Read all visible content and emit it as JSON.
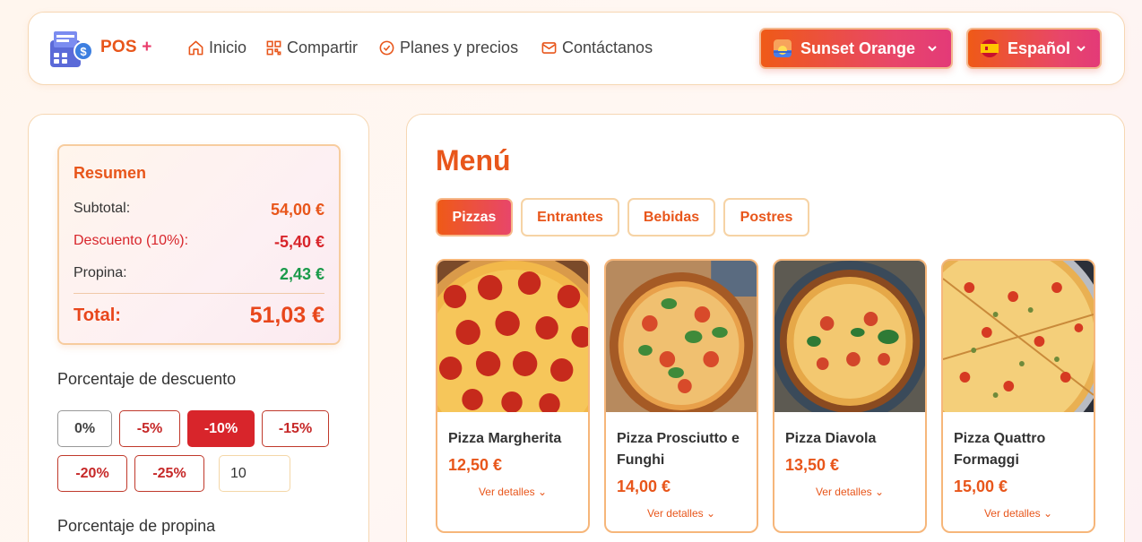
{
  "navbar": {
    "brand": "POS",
    "brand_plus": "+",
    "links": [
      {
        "label": "Inicio",
        "icon": "home-icon"
      },
      {
        "label": "Compartir",
        "icon": "qr-code-icon"
      },
      {
        "label": "Planes y precios",
        "icon": "check-badge-icon"
      },
      {
        "label": "Contáctanos",
        "icon": "mail-icon"
      }
    ],
    "theme_selector": {
      "label": "Sunset Orange",
      "icon": "sunset-emoji-icon"
    },
    "language_selector": {
      "label": "Español",
      "icon": "spain-flag-icon"
    }
  },
  "summary": {
    "title": "Resumen",
    "subtotal_label": "Subtotal:",
    "subtotal_value": "54,00 €",
    "discount_label": "Descuento (10%):",
    "discount_value": "-5,40 €",
    "tip_label": "Propina:",
    "tip_value": "2,43 €",
    "total_label": "Total:",
    "total_value": "51,03 €"
  },
  "discount": {
    "label": "Porcentaje de descuento",
    "options": [
      "0%",
      "-5%",
      "-10%",
      "-15%",
      "-20%",
      "-25%"
    ],
    "selected": "-10%",
    "custom_value": "10"
  },
  "tip": {
    "label": "Porcentaje de propina"
  },
  "menu": {
    "title": "Menú",
    "categories": [
      "Pizzas",
      "Entrantes",
      "Bebidas",
      "Postres"
    ],
    "active_category": "Pizzas",
    "details_label": "Ver detalles",
    "items": [
      {
        "name": "Pizza Margherita",
        "price": "12,50 €"
      },
      {
        "name": "Pizza Prosciutto e Funghi",
        "price": "14,00 €"
      },
      {
        "name": "Pizza Diavola",
        "price": "13,50 €"
      },
      {
        "name": "Pizza Quattro Formaggi",
        "price": "15,00 €"
      }
    ]
  },
  "colors": {
    "accent": "#e8561b",
    "accent_pink": "#e8466a",
    "discount_red": "#d8252b",
    "tip_green": "#1a9a4a"
  }
}
